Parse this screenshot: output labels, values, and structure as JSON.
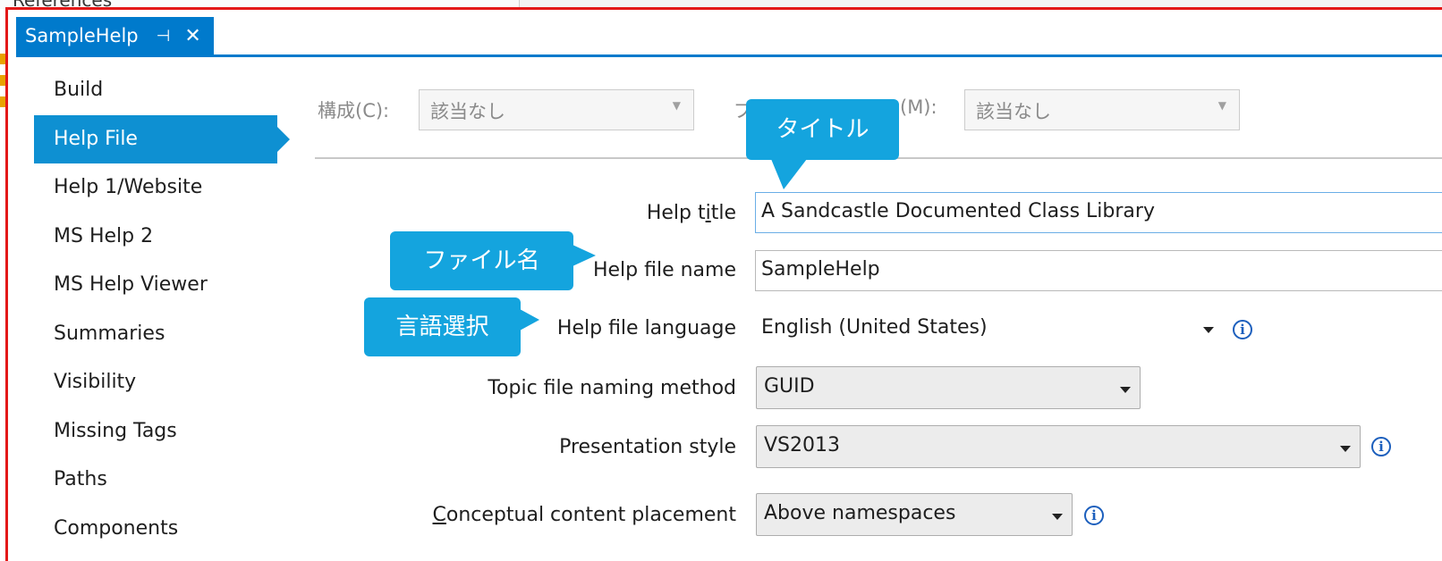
{
  "tab": {
    "title": "SampleHelp",
    "pin_icon": "pin-icon",
    "close_icon": "close-icon"
  },
  "background_fragment": "References",
  "nav": {
    "items": [
      "Build",
      "Help File",
      "Help 1/Website",
      "MS Help 2",
      "MS Help Viewer",
      "Summaries",
      "Visibility",
      "Missing Tags",
      "Paths",
      "Components"
    ],
    "active": "Help File"
  },
  "config": {
    "configuration_label": "構成(C):",
    "configuration_value": "該当なし",
    "platform_label_left": "プ",
    "platform_label_right": "(M):",
    "platform_value": "該当なし"
  },
  "fields": {
    "help_title": {
      "label_pre": "Help t",
      "label_u": "i",
      "label_post": "tle",
      "value": "A Sandcastle Documented Class Library"
    },
    "help_file_name": {
      "label": "Help file name",
      "value": "SampleHelp"
    },
    "help_file_language": {
      "label": "Help file language",
      "value": "English (United States)"
    },
    "topic_naming": {
      "label": "Topic file naming method",
      "value": "GUID"
    },
    "presentation_style": {
      "label": "Presentation style",
      "value": "VS2013"
    },
    "content_placement": {
      "label_u": "C",
      "label_post": "onceptual content placement",
      "value": "Above namespaces"
    }
  },
  "callouts": {
    "title": "タイトル",
    "file_name": "ファイル名",
    "language": "言語選択"
  },
  "colors": {
    "accent": "#007acc",
    "active_nav": "#0e90d2",
    "callout": "#14a4de",
    "highlight_border": "#e31818"
  }
}
